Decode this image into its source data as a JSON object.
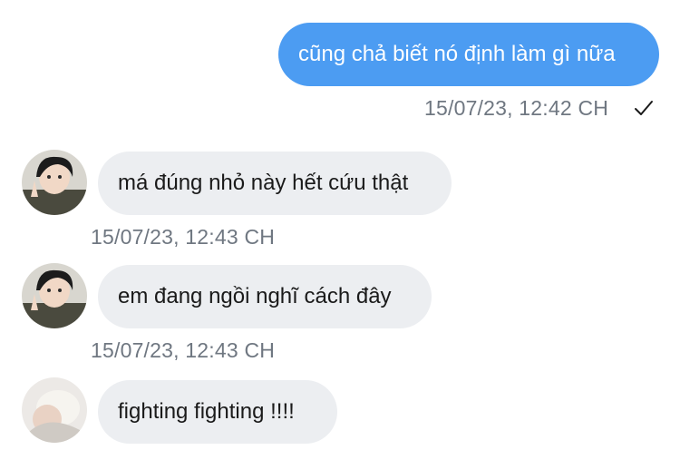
{
  "messages": [
    {
      "direction": "outgoing",
      "text": "cũng chả biết nó định làm gì nữa",
      "timestamp": "15/07/23, 12:42 CH",
      "status_icon": "checkmark-icon"
    },
    {
      "direction": "incoming",
      "avatar": "user-avatar-1",
      "text": "má đúng nhỏ này hết cứu thật",
      "timestamp": "15/07/23, 12:43 CH"
    },
    {
      "direction": "incoming",
      "avatar": "user-avatar-1",
      "text": "em đang ngồi nghĩ cách đây",
      "timestamp": "15/07/23, 12:43 CH"
    },
    {
      "direction": "incoming",
      "avatar": "user-avatar-2",
      "text": "fighting fighting !!!!"
    }
  ],
  "colors": {
    "outgoing_bubble": "#4c9cf2",
    "incoming_bubble": "#eceef1",
    "timestamp": "#6f7781"
  }
}
